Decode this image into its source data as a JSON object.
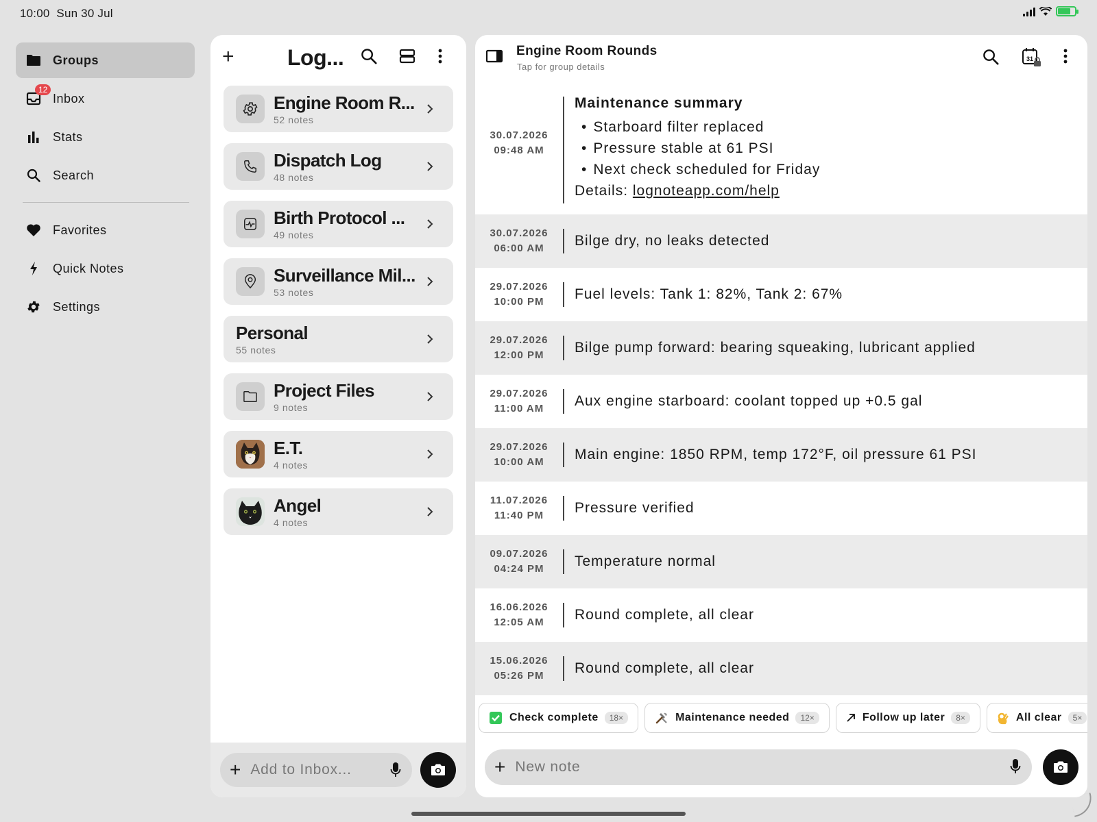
{
  "status_bar": {
    "time": "10:00",
    "date": "Sun 30 Jul"
  },
  "sidebar": {
    "items": [
      {
        "label": "Groups",
        "icon": "folder-icon",
        "active": true
      },
      {
        "label": "Inbox",
        "icon": "inbox-icon",
        "badge": "12"
      },
      {
        "label": "Stats",
        "icon": "bar-chart-icon"
      },
      {
        "label": "Search",
        "icon": "search-icon"
      }
    ],
    "secondary_items": [
      {
        "label": "Favorites",
        "icon": "heart-icon"
      },
      {
        "label": "Quick Notes",
        "icon": "bolt-icon"
      },
      {
        "label": "Settings",
        "icon": "gear-icon"
      }
    ]
  },
  "groups_panel": {
    "title": "Log...",
    "groups": [
      {
        "name": "Engine Room R...",
        "count": "52 notes",
        "icon": "gear-icon"
      },
      {
        "name": "Dispatch Log",
        "count": "48 notes",
        "icon": "phone-icon"
      },
      {
        "name": "Birth Protocol ...",
        "count": "49 notes",
        "icon": "heartbeat-icon"
      },
      {
        "name": "Surveillance Mil...",
        "count": "53 notes",
        "icon": "location-pin-icon"
      },
      {
        "name": "Personal",
        "count": "55 notes",
        "icon": ""
      },
      {
        "name": "Project Files",
        "count": "9 notes",
        "icon": "folder-icon"
      },
      {
        "name": "E.T.",
        "count": "4 notes",
        "icon": "cat-photo-icon"
      },
      {
        "name": "Angel",
        "count": "4 notes",
        "icon": "black-cat-photo-icon"
      }
    ],
    "inbox_placeholder": "Add to Inbox..."
  },
  "notes_panel": {
    "title": "Engine Room Rounds",
    "subtitle": "Tap for group details",
    "summary": {
      "date": "30.07.2026",
      "time": "09:48 AM",
      "title": "Maintenance summary",
      "bullets": [
        "Starboard filter replaced",
        "Pressure stable at 61 PSI",
        "Next check scheduled for Friday"
      ],
      "details_label": "Details:",
      "details_link": "lognoteapp.com/help"
    },
    "entries": [
      {
        "date": "30.07.2026",
        "time": "06:00 AM",
        "text": "Bilge dry, no leaks detected"
      },
      {
        "date": "29.07.2026",
        "time": "10:00 PM",
        "text": "Fuel levels: Tank 1: 82%, Tank 2: 67%"
      },
      {
        "date": "29.07.2026",
        "time": "12:00 PM",
        "text": "Bilge pump forward: bearing squeaking, lubricant applied"
      },
      {
        "date": "29.07.2026",
        "time": "11:00 AM",
        "text": "Aux engine starboard: coolant topped up +0.5 gal"
      },
      {
        "date": "29.07.2026",
        "time": "10:00 AM",
        "text": "Main engine: 1850 RPM, temp 172°F, oil pressure 61 PSI"
      },
      {
        "date": "11.07.2026",
        "time": "11:40 PM",
        "text": "Pressure verified"
      },
      {
        "date": "09.07.2026",
        "time": "04:24 PM",
        "text": "Temperature normal"
      },
      {
        "date": "16.06.2026",
        "time": "12:05 AM",
        "text": "Round complete, all clear"
      },
      {
        "date": "15.06.2026",
        "time": "05:26 PM",
        "text": "Round complete, all clear"
      }
    ],
    "chips": [
      {
        "label": "Check complete",
        "count": "18×",
        "icon": "check-box-icon"
      },
      {
        "label": "Maintenance needed",
        "count": "12×",
        "icon": "tools-icon"
      },
      {
        "label": "Follow up later",
        "count": "8×",
        "icon": "arrow-up-right-icon"
      },
      {
        "label": "All clear",
        "count": "5×",
        "icon": "ok-hand-icon"
      }
    ],
    "note_placeholder": "New note"
  },
  "colors": {
    "accent": "#111111",
    "badge": "#e5484d",
    "battery": "#34c759",
    "check": "#34c759"
  }
}
